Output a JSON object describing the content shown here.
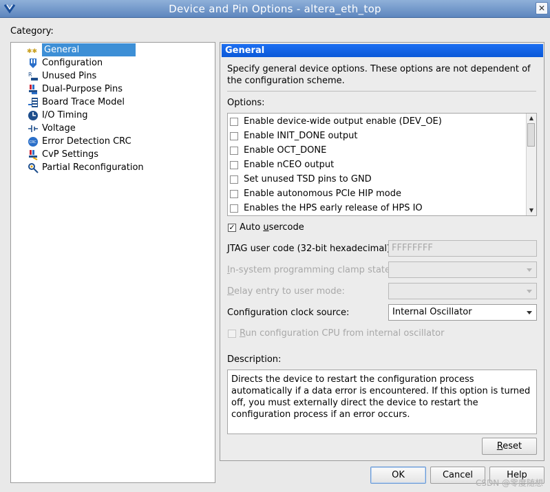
{
  "window": {
    "title": "Device and Pin Options - altera_eth_top",
    "close_glyph": "✕"
  },
  "category": {
    "label": "Category:",
    "items": [
      {
        "label": "General",
        "icon": "stars-icon",
        "selected": true
      },
      {
        "label": "Configuration",
        "icon": "configuration-icon"
      },
      {
        "label": "Unused Pins",
        "icon": "unused-pins-icon"
      },
      {
        "label": "Dual-Purpose Pins",
        "icon": "dual-purpose-pins-icon"
      },
      {
        "label": "Board Trace Model",
        "icon": "board-trace-icon"
      },
      {
        "label": "I/O Timing",
        "icon": "clock-icon"
      },
      {
        "label": "Voltage",
        "icon": "voltage-icon"
      },
      {
        "label": "Error Detection CRC",
        "icon": "crc-icon"
      },
      {
        "label": "CvP Settings",
        "icon": "cvp-icon"
      },
      {
        "label": "Partial Reconfiguration",
        "icon": "partial-reconfig-icon"
      }
    ]
  },
  "general": {
    "header": "General",
    "intro": "Specify general device options. These options are not dependent of the configuration scheme.",
    "options_label": "Options:",
    "options": [
      {
        "label": "Enable device-wide output enable (DEV_OE)",
        "checked": false
      },
      {
        "label": "Enable INIT_DONE output",
        "checked": false
      },
      {
        "label": "Enable OCT_DONE",
        "checked": false
      },
      {
        "label": "Enable nCEO output",
        "checked": false
      },
      {
        "label": "Set unused TSD pins to GND",
        "checked": false
      },
      {
        "label": "Enable autonomous PCIe HIP mode",
        "checked": false
      },
      {
        "label": "Enables the HPS early release of HPS IO",
        "checked": false
      }
    ],
    "auto_usercode": {
      "pre": "Auto ",
      "mn": "u",
      "post": "sercode",
      "checked": true,
      "check_glyph": "✓"
    },
    "jtag_label": "JTAG user code (32-bit hexadecimal):",
    "jtag_value": "FFFFFFFF",
    "clamp_label": {
      "mn": "I",
      "post": "n-system programming clamp state:"
    },
    "delay_label": {
      "mn": "D",
      "post": "elay entry to user mode:"
    },
    "clock_label": "Configuration clock source:",
    "clock_value": "Internal Oscillator",
    "run_cpu": {
      "mn": "R",
      "post": "un configuration CPU from internal oscillator"
    },
    "description_label": "Description:",
    "description": "Directs the device to restart the configuration process automatically if a data error is encountered. If this option is turned off, you must externally direct the device to restart the configuration process if an error occurs.",
    "reset": {
      "mn": "R",
      "post": "eset"
    }
  },
  "footer": {
    "ok": "OK",
    "cancel": "Cancel",
    "help": "Help",
    "watermark": "CSDN @零度随想"
  },
  "colors": {
    "header_blue": "#0a58d8",
    "selection_blue": "#3d8fd6",
    "titlebar": "#5d86be"
  }
}
